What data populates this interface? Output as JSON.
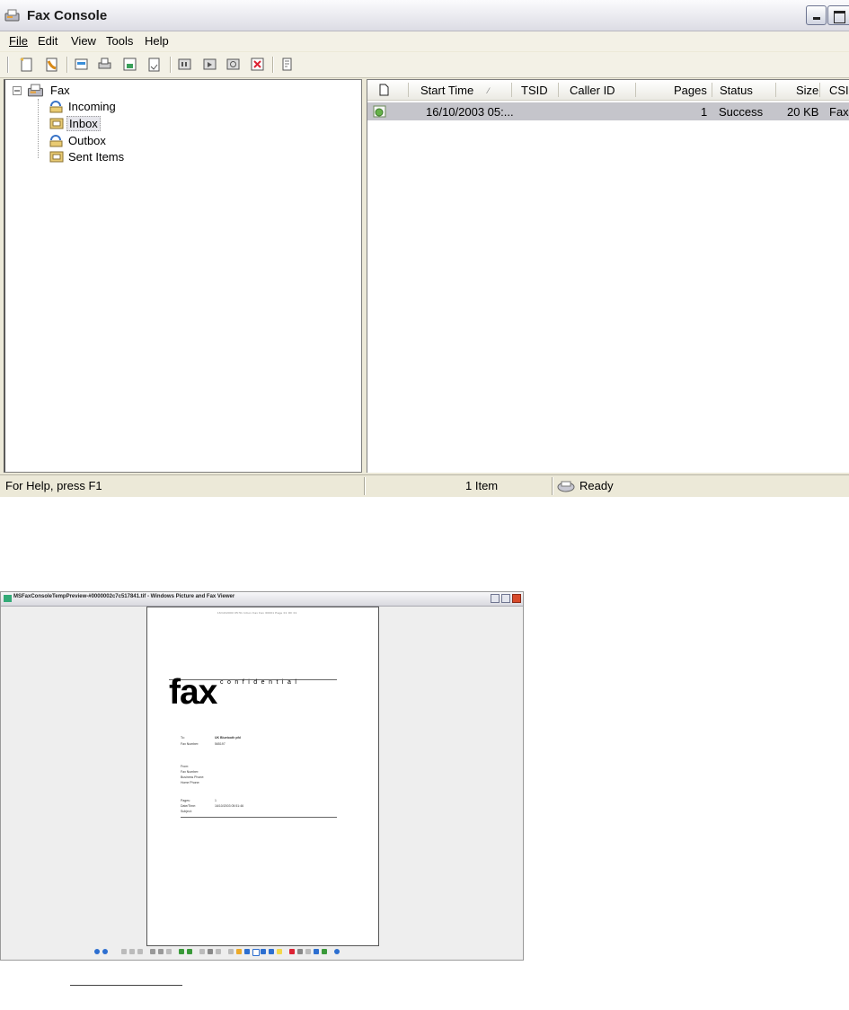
{
  "fax_console": {
    "title": "Fax Console",
    "menu": [
      "File",
      "Edit",
      "View",
      "Tools",
      "Help"
    ],
    "toolbar_icons": [
      "new-fax-icon",
      "receive-fax-icon",
      "view-icon",
      "print-icon",
      "save-icon",
      "mail-icon",
      "pause-icon",
      "resume-icon",
      "restart-icon",
      "delete-icon",
      "properties-icon"
    ],
    "tree": {
      "root": "Fax",
      "folders": [
        "Incoming",
        "Inbox",
        "Outbox",
        "Sent Items"
      ],
      "selected": "Inbox"
    },
    "list": {
      "columns": [
        "Start Time",
        "TSID",
        "Caller ID",
        "Pages",
        "Status",
        "Size",
        "CSI"
      ],
      "rows": [
        {
          "start_time": "16/10/2003 05:...",
          "tsid": "",
          "caller_id": "",
          "pages": "1",
          "status": "Success",
          "size": "20 KB",
          "csi": "Fax"
        }
      ]
    },
    "status": {
      "help": "For Help, press F1",
      "items": "1 Item",
      "state": "Ready"
    }
  },
  "viewer": {
    "title": "MSFaxConsoleTempPreview-#0000002c7c517841.tif - Windows Picture and Fax Viewer",
    "page": {
      "header_line": "16/10/2003 05:51  Inbox Fax   Fax 00001    Page 01 OF 01",
      "big_word": "fax",
      "subtitle": "confidential",
      "to_label": "To:",
      "to_value": "UK Bluetooth pfd",
      "fax_label": "Fax Number:",
      "fax_value": "565197",
      "from_label": "From:",
      "from_fax": "Fax Number:",
      "business_phone": "Business Phone:",
      "home_phone": "Home Phone:",
      "pages_label": "Pages:",
      "pages_value": "1",
      "date_label": "Date/Time:",
      "date_value": "16/10/2003 05:51:46",
      "subject_label": "Subject:"
    }
  },
  "colors": {
    "window_bg": "#ece9d8",
    "selection": "#c5c5cb",
    "close_red": "#d84a2b"
  }
}
